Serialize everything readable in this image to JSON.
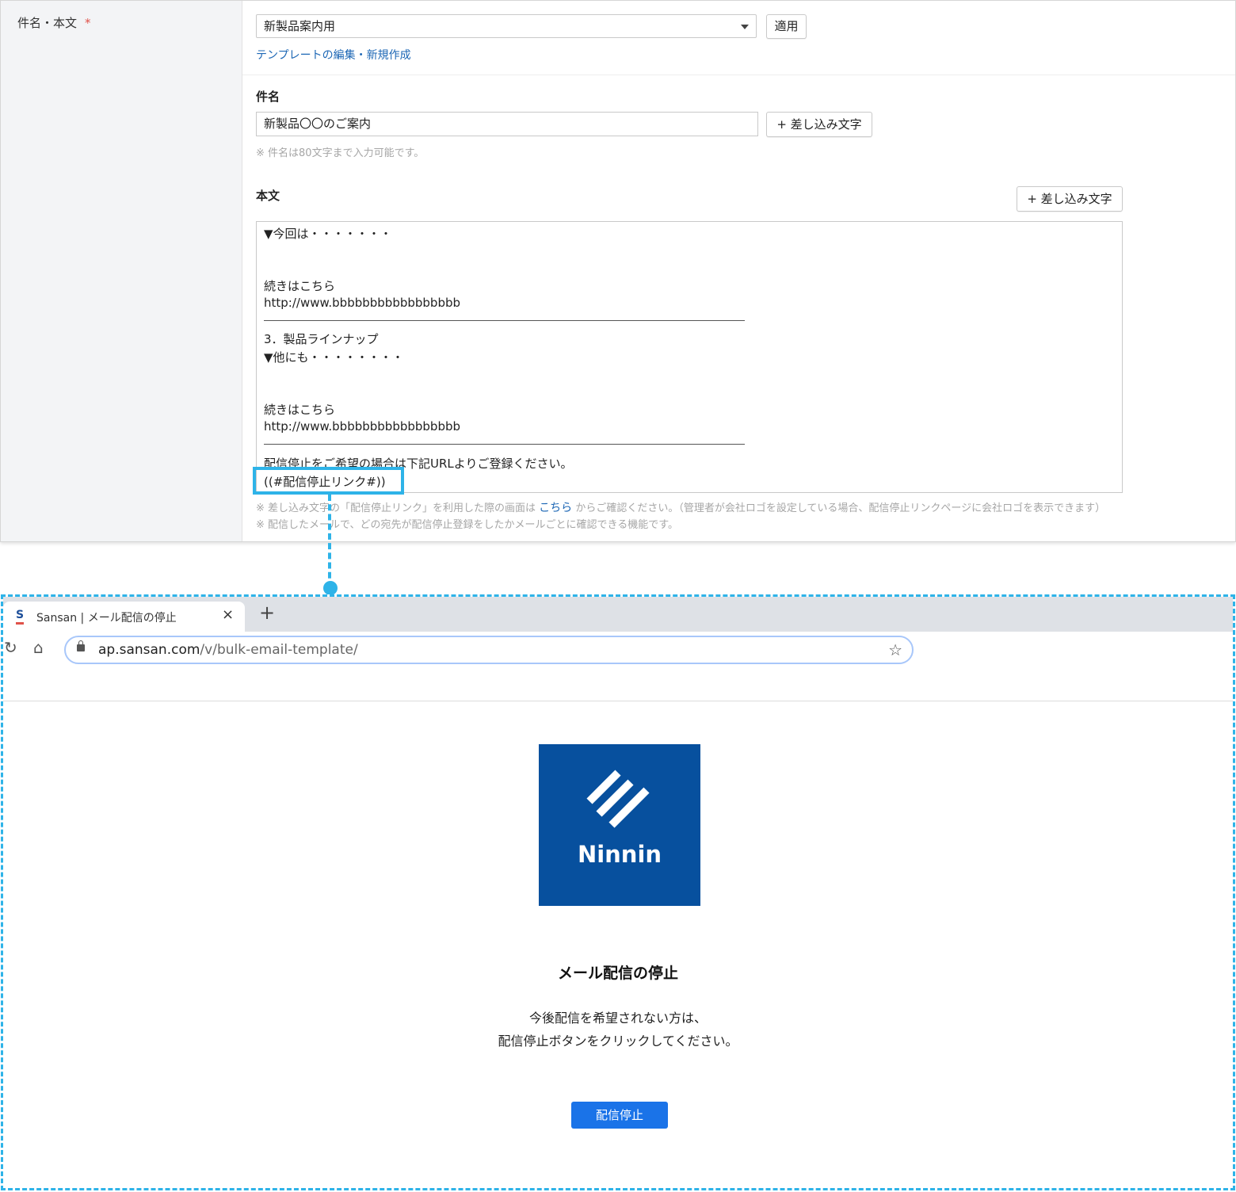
{
  "form": {
    "section_label": "件名・本文",
    "required_mark": "*",
    "template_value": "新製品案内用",
    "apply_label": "適用",
    "template_link": "テンプレートの編集・新規作成",
    "subject_label": "件名",
    "subject_value": "新製品〇〇のご案内",
    "insert_label": "+ 差し込み文字",
    "subject_note": "※ 件名は80文字まで入力可能です。",
    "body_label": "本文",
    "body_lines": [
      "▼今回は・・・・・・・",
      "続きはこちら",
      "http://www.bbbbbbbbbbbbbbbbb",
      "3．製品ラインナップ",
      "▼他にも・・・・・・・・",
      "続きはこちら",
      "http://www.bbbbbbbbbbbbbbbbb",
      "配信停止をご希望の場合は下記URLよりご登録ください。",
      "((#配信停止リンク#))"
    ],
    "note1_prefix": "※ 差し込み文字の「配信停止リンク」を利用した際の画面は",
    "note1_link": "こちら",
    "note1_suffix": "からご確認ください。（管理者が会社ロゴを設定している場合、配信停止リンクページに会社ロゴを表示できます）",
    "note2": "※ 配信したメールで、どの宛先が配信停止登録をしたかメールごとに確認できる機能です。"
  },
  "browser": {
    "favicon": "S",
    "tab_title": "Sansan | メール配信の停止",
    "close_icon": "×",
    "new_tab_icon": "+",
    "url_host": "ap.sansan.com",
    "url_path": "/v/bulk-email-template/"
  },
  "page": {
    "logo_text": "Ninnin",
    "title": "メール配信の停止",
    "desc_line1": "今後配信を希望されない方は、",
    "desc_line2": "配信停止ボタンをクリックしてください。",
    "button_label": "配信停止"
  },
  "colors": {
    "highlight": "#2eb3e8",
    "link": "#1d67b5",
    "logo_bg": "#07509e",
    "button": "#1a73e8"
  }
}
